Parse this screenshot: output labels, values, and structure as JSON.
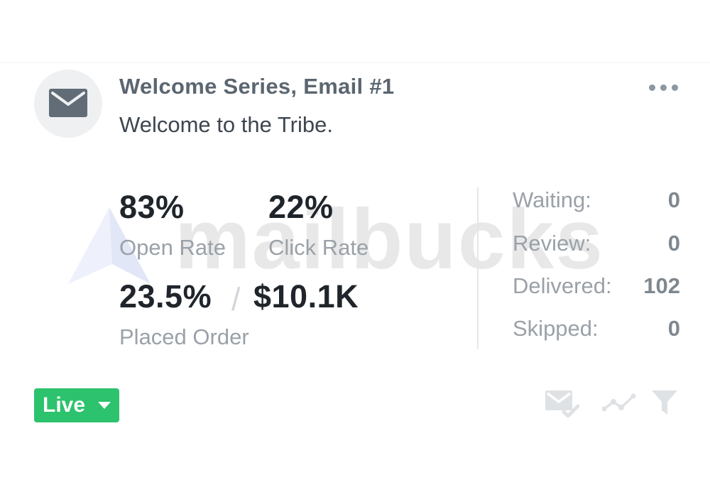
{
  "header": {
    "title": "Welcome Series, Email #1",
    "subject": "Welcome to the Tribe."
  },
  "icons": {
    "message": "envelope-icon",
    "menu": "more-dots-icon",
    "status_caret": "caret-down-icon",
    "tools": [
      "mail-check-icon",
      "trend-line-icon",
      "filter-icon"
    ]
  },
  "metrics": {
    "open_rate_value": "83%",
    "open_rate_label": "Open Rate",
    "click_rate_value": "22%",
    "click_rate_label": "Click Rate",
    "placed_order_rate": "23.5%",
    "separator": "/",
    "placed_order_revenue": "$10.1K",
    "placed_order_label": "Placed Order"
  },
  "stats": [
    {
      "label": "Waiting:",
      "value": "0"
    },
    {
      "label": "Review:",
      "value": "0"
    },
    {
      "label": "Delivered:",
      "value": "102"
    },
    {
      "label": "Skipped:",
      "value": "0"
    }
  ],
  "status": {
    "label": "Live",
    "color": "#2dc26d"
  },
  "watermark": {
    "text": "mailbucks"
  }
}
